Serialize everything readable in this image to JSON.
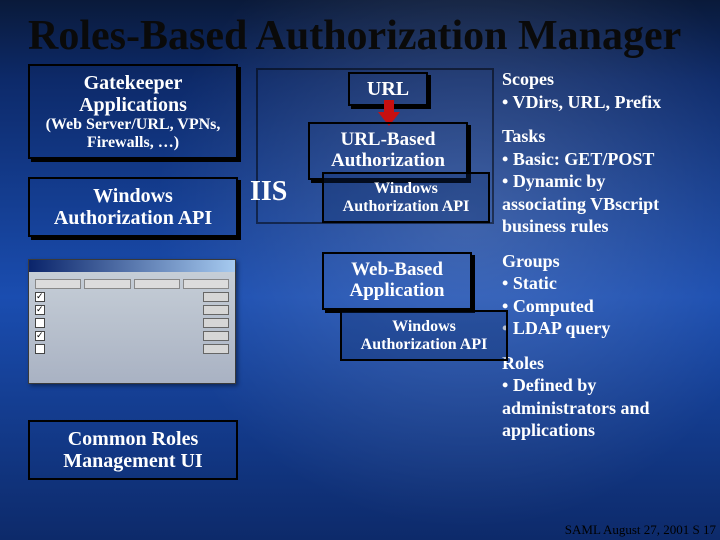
{
  "title": "Roles-Based Authorization Manager",
  "footer": "SAML August 27, 2001 S 17",
  "left": {
    "gatekeeper": {
      "title": "Gatekeeper Applications",
      "subtitle": "(Web Server/URL, VPNs, Firewalls, …)"
    },
    "api": "Windows Authorization API",
    "common_ui": "Common Roles Management UI"
  },
  "center": {
    "iis_label": "IIS",
    "url_pill": "URL",
    "url_based": "URL-Based Authorization",
    "win_api_1": "Windows Authorization API",
    "web_based": "Web-Based Application",
    "win_api_2": "Windows Authorization API"
  },
  "right": {
    "scopes": {
      "heading": "Scopes",
      "items": [
        "VDirs, URL, Prefix"
      ]
    },
    "tasks": {
      "heading": "Tasks",
      "items": [
        "Basic: GET/POST",
        "Dynamic by associating VBscript business rules"
      ]
    },
    "groups": {
      "heading": "Groups",
      "items": [
        "Static",
        "Computed",
        "LDAP query"
      ]
    },
    "roles": {
      "heading": "Roles",
      "items": [
        "Defined by administrators and applications"
      ]
    }
  }
}
